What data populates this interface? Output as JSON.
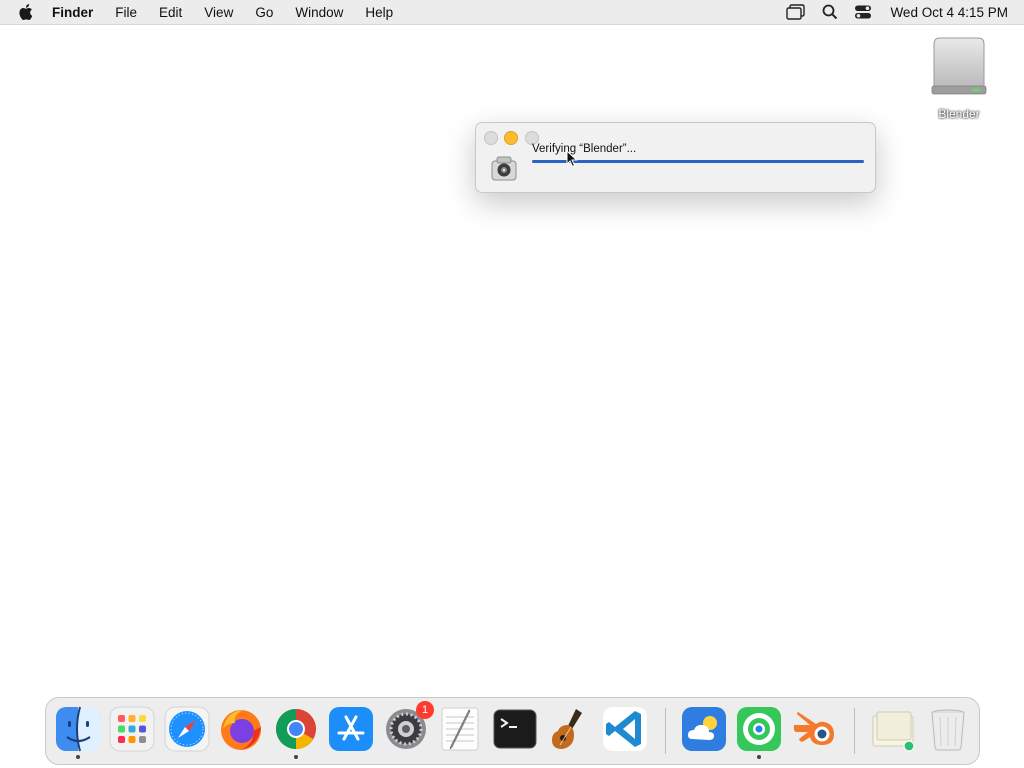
{
  "menubar": {
    "app_name": "Finder",
    "items": [
      "File",
      "Edit",
      "View",
      "Go",
      "Window",
      "Help"
    ],
    "clock": "Wed Oct 4  4:15 PM",
    "status_icons": [
      "window-mirror-icon",
      "spotlight-search-icon",
      "control-center-icon"
    ]
  },
  "desktop": {
    "disk_label": "Blender"
  },
  "dialog": {
    "title": "Verifying “Blender”...",
    "progress_fraction": 1.0,
    "accent_color": "#2a63c2"
  },
  "dock": {
    "items": [
      {
        "name": "finder-icon",
        "running": true
      },
      {
        "name": "launchpad-icon",
        "running": false
      },
      {
        "name": "safari-icon",
        "running": false
      },
      {
        "name": "firefox-icon",
        "running": false
      },
      {
        "name": "chrome-icon",
        "running": true
      },
      {
        "name": "app-store-icon",
        "running": false
      },
      {
        "name": "system-settings-icon",
        "running": false,
        "badge": "1"
      },
      {
        "name": "textedit-icon",
        "running": false
      },
      {
        "name": "terminal-icon",
        "running": false
      },
      {
        "name": "garageband-icon",
        "running": false
      },
      {
        "name": "vscode-icon",
        "running": false
      },
      {
        "name": "weather-icon",
        "running": false
      },
      {
        "name": "find-my-icon",
        "running": true
      },
      {
        "name": "blender-icon",
        "running": false
      },
      {
        "name": "preview-icon",
        "running": false
      },
      {
        "name": "trash-icon",
        "running": false
      }
    ],
    "settings_badge": "1"
  }
}
